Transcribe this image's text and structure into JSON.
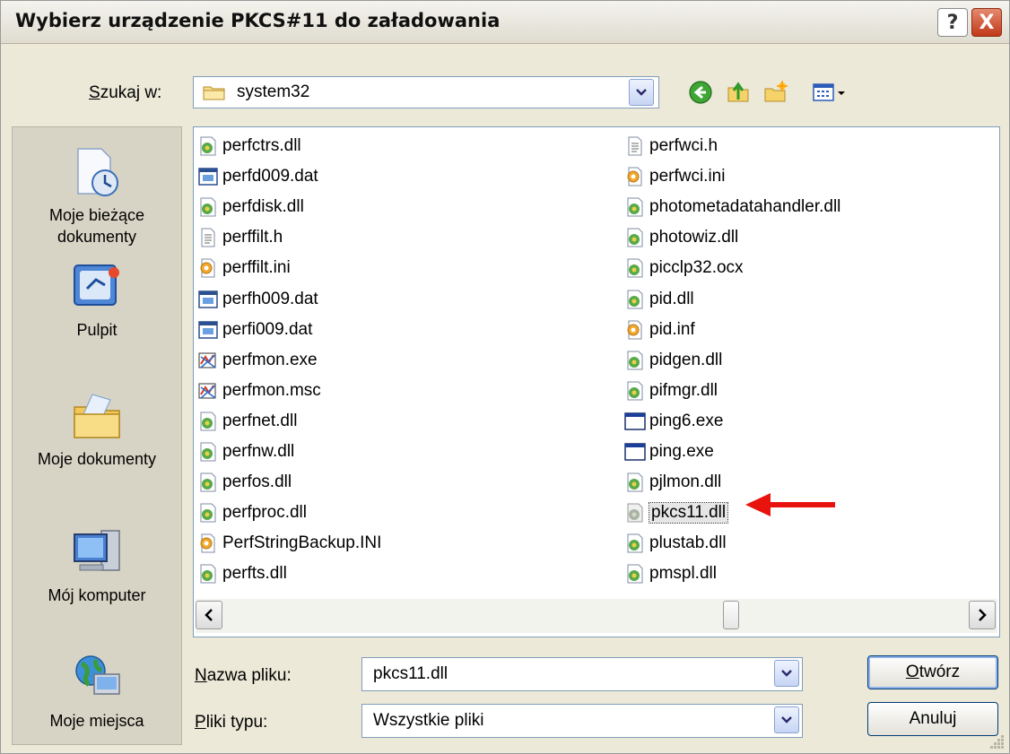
{
  "window": {
    "title": "Wybierz urządzenie PKCS#11 do załadowania",
    "help_glyph": "?",
    "close_glyph": "X"
  },
  "lookin": {
    "label_key": "S",
    "label_rest": "zukaj w:",
    "value": "system32"
  },
  "toolbar": {
    "icons": [
      "back-icon",
      "up-folder-icon",
      "new-folder-icon",
      "view-menu-icon"
    ]
  },
  "places": [
    {
      "label": "Moje bieżące dokumenty",
      "icon": "recent-documents-icon"
    },
    {
      "label": "Pulpit",
      "icon": "desktop-icon"
    },
    {
      "label": "Moje dokumenty",
      "icon": "my-documents-icon"
    },
    {
      "label": "Mój komputer",
      "icon": "my-computer-icon"
    },
    {
      "label": "Moje miejsca",
      "icon": "network-places-icon"
    }
  ],
  "files": {
    "col1": [
      {
        "name": "perfctrs.dll",
        "icon": "dll"
      },
      {
        "name": "perfd009.dat",
        "icon": "dat"
      },
      {
        "name": "perfdisk.dll",
        "icon": "dll"
      },
      {
        "name": "perffilt.h",
        "icon": "txt"
      },
      {
        "name": "perffilt.ini",
        "icon": "ini"
      },
      {
        "name": "perfh009.dat",
        "icon": "dat"
      },
      {
        "name": "perfi009.dat",
        "icon": "dat"
      },
      {
        "name": "perfmon.exe",
        "icon": "perfmon"
      },
      {
        "name": "perfmon.msc",
        "icon": "perfmon"
      },
      {
        "name": "perfnet.dll",
        "icon": "dll"
      },
      {
        "name": "perfnw.dll",
        "icon": "dll"
      },
      {
        "name": "perfos.dll",
        "icon": "dll"
      },
      {
        "name": "perfproc.dll",
        "icon": "dll"
      },
      {
        "name": "PerfStringBackup.INI",
        "icon": "ini"
      },
      {
        "name": "perfts.dll",
        "icon": "dll"
      }
    ],
    "col2": [
      {
        "name": "perfwci.h",
        "icon": "txt"
      },
      {
        "name": "perfwci.ini",
        "icon": "ini"
      },
      {
        "name": "photometadatahandler.dll",
        "icon": "dll"
      },
      {
        "name": "photowiz.dll",
        "icon": "dll"
      },
      {
        "name": "picclp32.ocx",
        "icon": "dll"
      },
      {
        "name": "pid.dll",
        "icon": "dll"
      },
      {
        "name": "pid.inf",
        "icon": "ini"
      },
      {
        "name": "pidgen.dll",
        "icon": "dll"
      },
      {
        "name": "pifmgr.dll",
        "icon": "dll"
      },
      {
        "name": "ping6.exe",
        "icon": "exe"
      },
      {
        "name": "ping.exe",
        "icon": "exe"
      },
      {
        "name": "pjlmon.dll",
        "icon": "dll"
      },
      {
        "name": "pkcs11.dll",
        "icon": "dll-gray",
        "selected": true
      },
      {
        "name": "plustab.dll",
        "icon": "dll"
      },
      {
        "name": "pmspl.dll",
        "icon": "dll"
      }
    ]
  },
  "filename": {
    "label_key": "N",
    "label_rest": "azwa pliku:",
    "value": "pkcs11.dll"
  },
  "filetype": {
    "label_key": "P",
    "label_rest": "liki typu:",
    "value": "Wszystkie pliki"
  },
  "buttons": {
    "open_key": "O",
    "open_rest": "twórz",
    "cancel": "Anuluj"
  },
  "colors": {
    "dialog_bg": "#ece9d8",
    "field_border": "#7f9db9",
    "annotation_arrow": "#e8130d"
  }
}
